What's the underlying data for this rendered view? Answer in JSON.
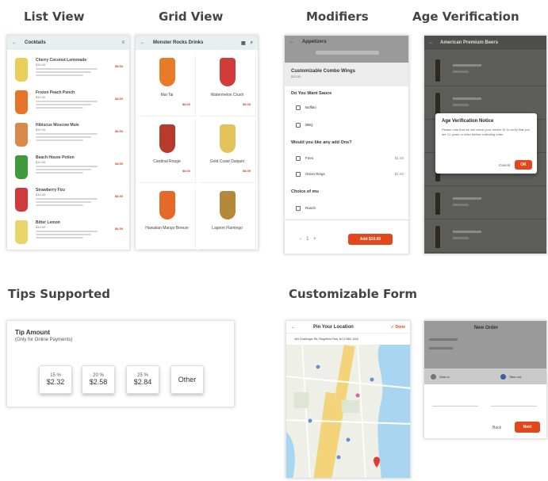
{
  "headings": {
    "list_view": "List View",
    "grid_view": "Grid View",
    "modifiers": "Modifiers",
    "age_verification": "Age Verification",
    "tips_supported": "Tips Supported",
    "customizable_form": "Customizable Form"
  },
  "list_view": {
    "title": "Cocktails",
    "items": [
      {
        "name": "Cherry Coconut Lemonade",
        "price": "$10.00",
        "badge": "$8.50"
      },
      {
        "name": "Frozen Peach Punch",
        "price": "$10.00",
        "badge": "$8.50"
      },
      {
        "name": "Hibiscus Moscow Mule",
        "price": "$10.00",
        "badge": "$8.50"
      },
      {
        "name": "Beach House Potion",
        "price": "$10.00",
        "badge": "$8.50"
      },
      {
        "name": "Strawberry Fizz",
        "price": "$10.00",
        "badge": "$8.50"
      },
      {
        "name": "Bitter Lemon",
        "price": "$10.00",
        "badge": "$8.50"
      }
    ]
  },
  "grid_view": {
    "title": "Monster Rocks Drinks",
    "items": [
      {
        "name": "Mai Tai",
        "price": "$8.00"
      },
      {
        "name": "Watermelon Crush",
        "price": "$8.00"
      },
      {
        "name": "Cardinal Rouge",
        "price": "$8.00"
      },
      {
        "name": "Gold Coast Daiquiri",
        "price": "$8.00"
      },
      {
        "name": "Hawaiian Mango Breeze",
        "price": ""
      },
      {
        "name": "Lagoon Flamingo",
        "price": ""
      }
    ]
  },
  "modifiers": {
    "title": "Appetizers",
    "product": "Customizable Combo Wings",
    "price": "$10.00",
    "section1": "Do You Want Sauce",
    "options1": [
      "Buffalo",
      "BBQ"
    ],
    "section2": "Would you like any add Ons?",
    "options2": [
      {
        "label": "Fries",
        "price": "$1.00"
      },
      {
        "label": "Onion Rings",
        "price": "$1.50"
      }
    ],
    "section3": "Choice of mu",
    "options3": [
      "Ranch"
    ],
    "add_button": "Add $10.00"
  },
  "age_verification": {
    "title": "American Premium Beers",
    "dialog_title": "Age Verification Notice",
    "dialog_text": "Please note that we will check your drivers ID to verify that you are 21 years or older before collecting order.",
    "cancel": "Cancel",
    "ok": "OK"
  },
  "tips": {
    "title": "Tip Amount",
    "subtitle": "(Only for Online Payments)",
    "options": [
      {
        "percent": "15 %",
        "amount": "$2.32"
      },
      {
        "percent": "20 %",
        "amount": "$2.58"
      },
      {
        "percent": "25 %",
        "amount": "$2.84"
      }
    ],
    "other": "Other"
  },
  "location_form": {
    "title": "Pin Your Location",
    "done": "Done",
    "address": "463 Challenger Rd, Ridgefield Park, NJ 07660, USA"
  },
  "new_order": {
    "title": "New Order",
    "option_a": "Dine-in",
    "option_b": "Take-out",
    "field1": "",
    "field2": "",
    "back": "Back",
    "next": "Next"
  },
  "colors": {
    "accent": "#e5471d",
    "header_bg": "#e8f0ef",
    "modifier_header": "#9a9a9a",
    "dark_overlay": "#5d5d5a",
    "map_water": "#a8d5ef",
    "map_land": "#eef0e8",
    "road": "#f3d47a"
  }
}
